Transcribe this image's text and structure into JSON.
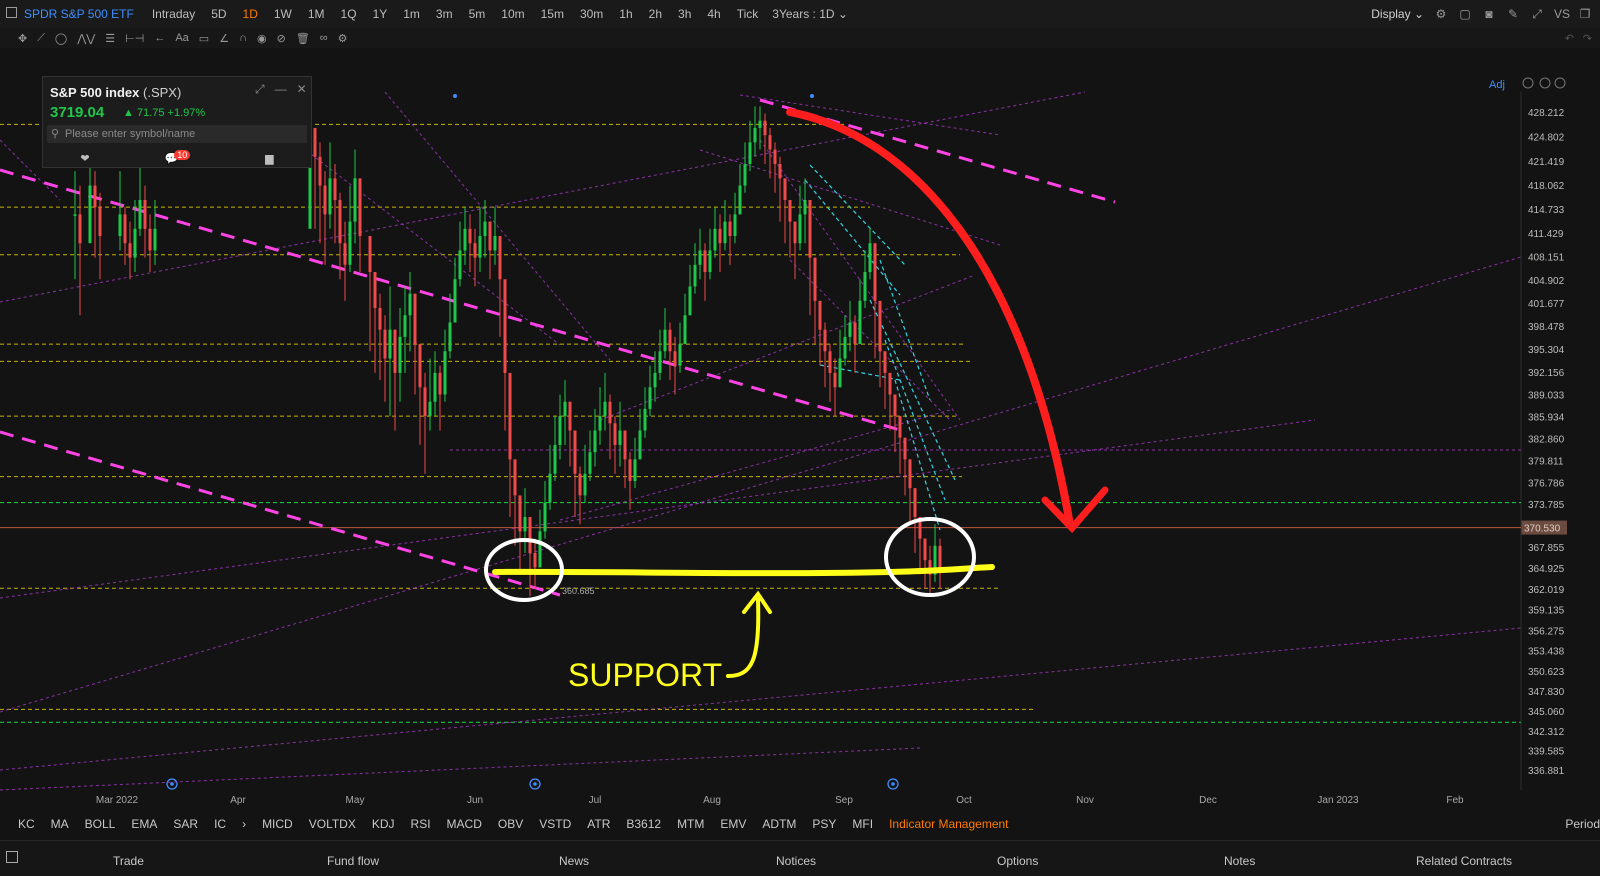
{
  "header": {
    "symbol": "SPDR S&P 500 ETF",
    "timeframes": [
      "Intraday",
      "5D",
      "1D",
      "1W",
      "1M",
      "1Q",
      "1Y",
      "1m",
      "3m",
      "5m",
      "10m",
      "15m",
      "30m",
      "1h",
      "2h",
      "3h",
      "4h",
      "Tick"
    ],
    "active_timeframe": "1D",
    "range_label": "3Years : 1D",
    "display_label": "Display"
  },
  "quote_panel": {
    "name": "S&P 500 index",
    "code": "(.SPX)",
    "price": "3719.04",
    "change": "71.75 +1.97%",
    "search_placeholder": "Please enter symbol/name",
    "comment_count": "10"
  },
  "chart": {
    "adj_label": "Adj",
    "current_price": "370.530",
    "low_label": "360.685",
    "annotation_text": "SUPPORT",
    "colors": {
      "up": "#1fc74a",
      "down": "#f04a4a",
      "bg": "#131313",
      "annotation_red": "#ff1e1e",
      "annotation_yellow": "#ffff1a",
      "level_line": "#c8b400",
      "green_level": "#19c337"
    }
  },
  "chart_data": {
    "type": "candlestick",
    "price_axis": [
      "428.212",
      "424.802",
      "421.419",
      "418.062",
      "414.733",
      "411.429",
      "408.151",
      "404.902",
      "401.677",
      "398.478",
      "395.304",
      "392.156",
      "389.033",
      "385.934",
      "382.860",
      "379.811",
      "376.786",
      "373.785",
      "370.530",
      "367.855",
      "364.925",
      "362.019",
      "359.135",
      "356.275",
      "353.438",
      "350.623",
      "347.830",
      "345.060",
      "342.312",
      "339.585",
      "336.881"
    ],
    "date_axis": [
      "Mar 2022",
      "Apr",
      "May",
      "Jun",
      "Jul",
      "Aug",
      "Sep",
      "Oct",
      "Nov",
      "Dec",
      "Jan 2023",
      "Feb"
    ],
    "horizontal_levels": [
      426.5,
      415.0,
      408.4,
      396.0,
      393.6,
      386.0,
      377.6,
      374.0,
      362.1,
      345.3,
      343.5
    ],
    "support_level": 362.1,
    "current_price": 370.53,
    "low": 360.685
  },
  "indicators": [
    "KC",
    "MA",
    "BOLL",
    "EMA",
    "SAR",
    "IC",
    "MICD",
    "VOLTDX",
    "KDJ",
    "RSI",
    "MACD",
    "OBV",
    "VSTD",
    "ATR",
    "B3612",
    "MTM",
    "EMV",
    "ADTM",
    "PSY",
    "MFI"
  ],
  "indicator_management": "Indicator Management",
  "period_label": "Period",
  "bottom_tabs": [
    "Trade",
    "Fund flow",
    "News",
    "Notices",
    "Options",
    "Notes",
    "Related Contracts"
  ]
}
